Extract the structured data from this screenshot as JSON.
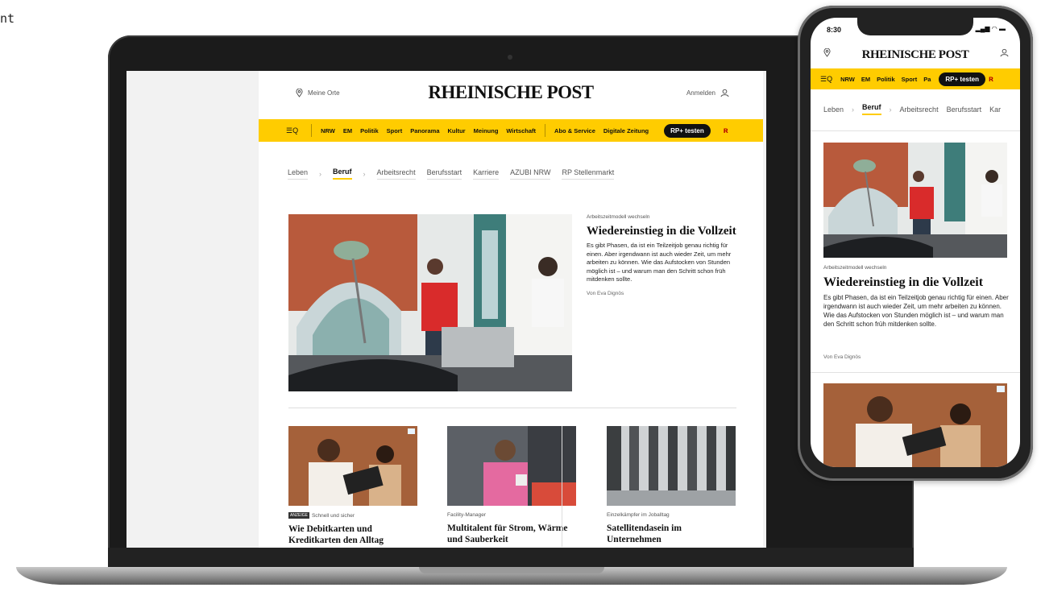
{
  "corner_text": "nt",
  "laptop": {
    "header": {
      "location_label": "Meine Orte",
      "logo": "RHEINISCHE POST",
      "login_label": "Anmelden"
    },
    "nav": {
      "menu_icon": "menu-search-icon",
      "menu_glyph": "☰Q",
      "items": [
        "NRW",
        "EM",
        "Politik",
        "Sport",
        "Panorama",
        "Kultur",
        "Meinung",
        "Wirtschaft"
      ],
      "service_items": [
        "Abo & Service",
        "Digitale Zeitung"
      ],
      "cta": "RP+ testen",
      "extra_glyph": "ʀ"
    },
    "subnav": {
      "items": [
        "Leben",
        "Beruf",
        "Arbeitsrecht",
        "Berufsstart",
        "Karriere",
        "AZUBI NRW",
        "RP Stellenmarkt"
      ],
      "active": "Beruf"
    },
    "hero": {
      "kicker": "Arbeitszeitmodell wechseln",
      "headline": "Wiedereinstieg in die Vollzeit",
      "teaser": "Es gibt Phasen, da ist ein Teilzeitjob genau richtig für einen. Aber irgendwann ist auch wieder Zeit, um mehr arbeiten zu können. Wie das Aufstocken von Stunden möglich ist – und warum man den Schritt schon früh mitdenken sollte.",
      "byline": "Von Eva Dignös"
    },
    "cards": [
      {
        "badge": "ANZEIGE",
        "kicker": "Schnell und sicher",
        "title": "Wie Debitkarten und Kreditkarten den Alltag"
      },
      {
        "kicker": "Facility-Manager",
        "title": "Multitalent für Strom, Wärme und Sauberkeit"
      },
      {
        "kicker": "Einzelkämpfer im Joballtag",
        "title": "Satellitendasein im Unternehmen"
      }
    ]
  },
  "phone": {
    "time": "8:30",
    "status": "▂▄▆ ◠ ▬",
    "logo": "RHEINISCHE POST",
    "nav": {
      "menu_glyph": "☰Q",
      "items": [
        "NRW",
        "EM",
        "Politik",
        "Sport",
        "Pa"
      ],
      "cta": "RP+ testen",
      "extra_glyph": "ʀ"
    },
    "subnav": {
      "items": [
        "Leben",
        "Beruf",
        "Arbeitsrecht",
        "Berufsstart",
        "Kar"
      ],
      "active": "Beruf"
    },
    "hero": {
      "kicker": "Arbeitszeitmodell wechseln",
      "headline": "Wiedereinstieg in die Vollzeit",
      "teaser": "Es gibt Phasen, da ist ein Teilzeitjob genau richtig für einen. Aber irgendwann ist auch wieder Zeit, um mehr arbeiten zu können. Wie das Aufstocken von Stunden möglich ist – und warum man den Schritt schon früh mitdenken sollte.",
      "byline": "Von Eva Dignös"
    }
  },
  "colors": {
    "brand_yellow": "#ffcc00",
    "cta_black": "#111111"
  }
}
